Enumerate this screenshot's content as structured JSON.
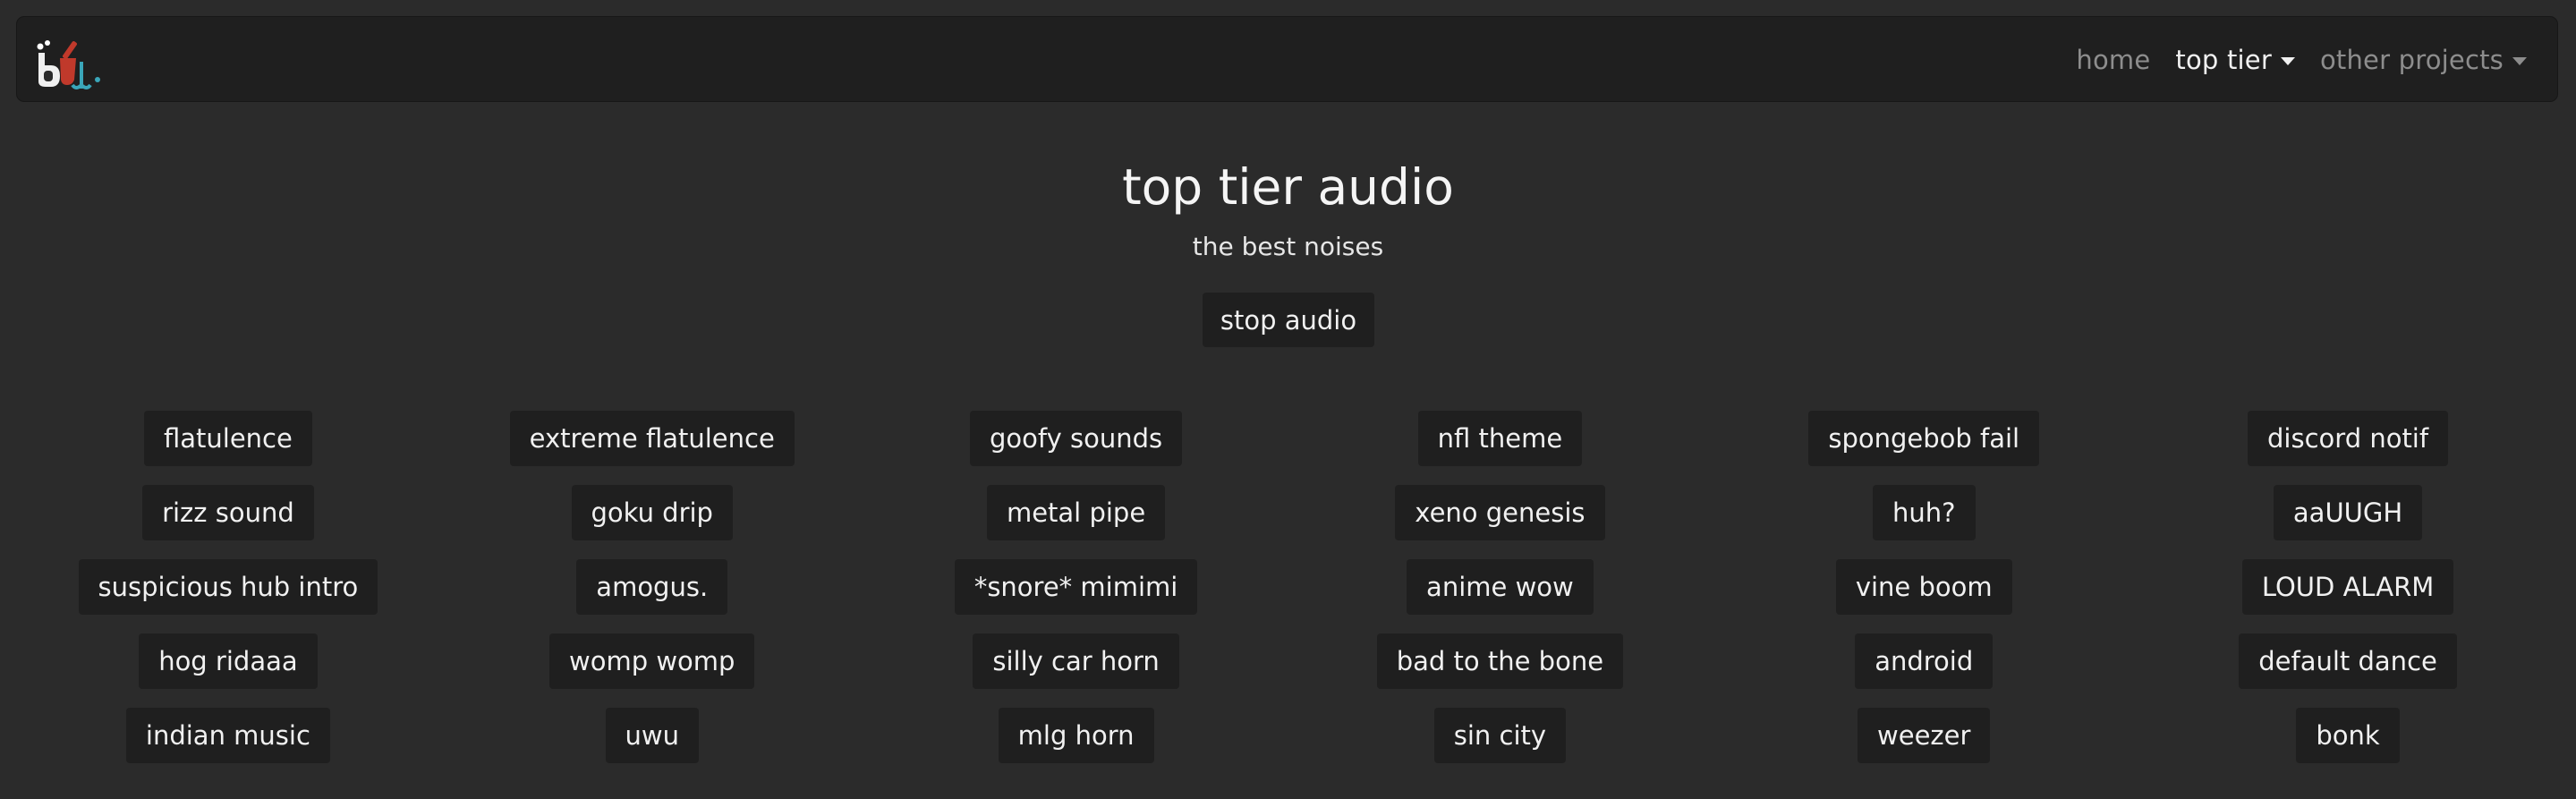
{
  "nav": {
    "logo_alt": "bup",
    "links": [
      {
        "label": "home",
        "active": false,
        "dropdown": false
      },
      {
        "label": "top tier",
        "active": true,
        "dropdown": true
      },
      {
        "label": "other projects",
        "active": false,
        "dropdown": true
      }
    ]
  },
  "page": {
    "title": "top tier audio",
    "subtitle": "the best noises",
    "stop_label": "stop audio"
  },
  "sounds": [
    [
      "flatulence",
      "extreme flatulence",
      "goofy sounds",
      "nfl theme",
      "spongebob fail",
      "discord notif"
    ],
    [
      "rizz sound",
      "goku drip",
      "metal pipe",
      "xeno genesis",
      "huh?",
      "aaUUGH"
    ],
    [
      "suspicious hub intro",
      "amogus.",
      "*snore* mimimi",
      "anime wow",
      "vine boom",
      "LOUD ALARM"
    ],
    [
      "hog ridaaa",
      "womp womp",
      "silly car horn",
      "bad to the bone",
      "android",
      "default dance"
    ],
    [
      "indian music",
      "uwu",
      "mlg horn",
      "sin city",
      "weezer",
      "bonk"
    ]
  ],
  "colors": {
    "background": "#2b2b2b",
    "navbar": "#1f1f1f",
    "button": "#1f1f1f",
    "text": "#f1f1f1",
    "muted": "#8d8d8d",
    "logo_red": "#c0392b",
    "logo_teal": "#3aa6b9"
  }
}
